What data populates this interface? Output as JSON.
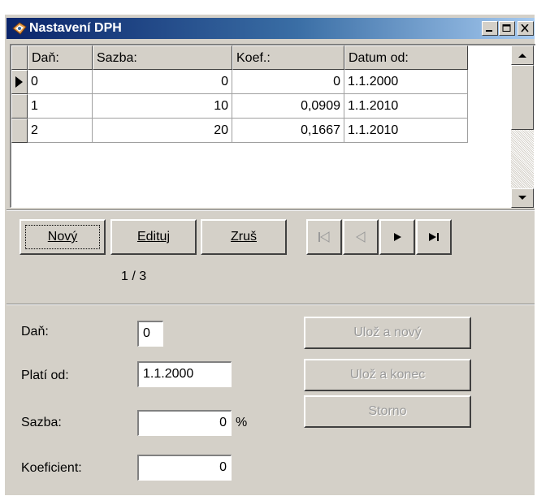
{
  "window": {
    "title": "Nastavení DPH"
  },
  "grid": {
    "columns": [
      "Daň:",
      "Sazba:",
      "Koef.:",
      "Datum od:"
    ],
    "rows": [
      {
        "dan": "0",
        "sazba": "0",
        "koef": "0",
        "datum": "1.1.2000",
        "current": true
      },
      {
        "dan": "1",
        "sazba": "10",
        "koef": "0,0909",
        "datum": "1.1.2010",
        "current": false
      },
      {
        "dan": "2",
        "sazba": "20",
        "koef": "0,1667",
        "datum": "1.1.2010",
        "current": false
      }
    ]
  },
  "toolbar": {
    "new_label": "Nový",
    "edit_label": "Edituj",
    "delete_label": "Zruš",
    "record_position": "1 / 3"
  },
  "navigator": {
    "icons": [
      "first-record-icon",
      "previous-record-icon",
      "next-record-icon",
      "last-record-icon"
    ],
    "enabled": [
      false,
      false,
      true,
      true
    ]
  },
  "form": {
    "dan_label": "Daň:",
    "dan_value": "0",
    "plati_od_label": "Platí od:",
    "plati_od_value": "1.1.2000",
    "sazba_label": "Sazba:",
    "sazba_value": "0",
    "sazba_unit": "%",
    "koeficient_label": "Koeficient:",
    "koeficient_value": "0"
  },
  "actions": {
    "save_new_label": "Ulož a nový",
    "save_close_label": "Ulož a konec",
    "cancel_label": "Storno",
    "enabled": false
  },
  "colors": {
    "titlebar_start": "#0a246a",
    "titlebar_end": "#a6caf0",
    "face": "#d4d0c8",
    "disabled_text": "#9a9a9a"
  }
}
